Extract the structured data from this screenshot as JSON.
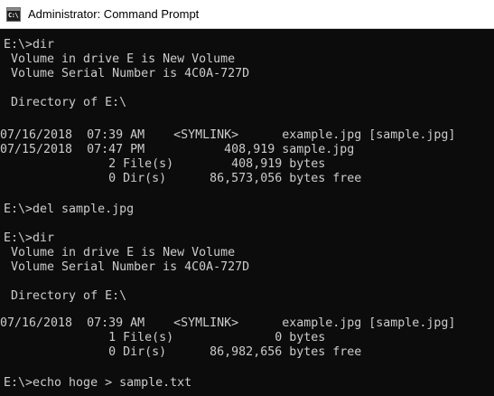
{
  "window": {
    "title": "Administrator: Command Prompt",
    "icon": "console-app-icon",
    "icon_glyph": "C:\\",
    "background_color": "#0c0c0c",
    "text_color": "#cccccc"
  },
  "console": {
    "lines": [
      "E:\\>dir",
      " Volume in drive E is New Volume",
      " Volume Serial Number is 4C0A-727D",
      "",
      " Directory of E:\\",
      "",
      "07/16/2018  07:39 AM    <SYMLINK>      example.jpg [sample.jpg]",
      "07/15/2018  07:47 PM           408,919 sample.jpg",
      "               2 File(s)        408,919 bytes",
      "               0 Dir(s)      86,573,056 bytes free",
      "",
      "E:\\>del sample.jpg",
      "",
      "E:\\>dir",
      " Volume in drive E is New Volume",
      " Volume Serial Number is 4C0A-727D",
      "",
      " Directory of E:\\",
      "",
      "07/16/2018  07:39 AM    <SYMLINK>      example.jpg [sample.jpg]",
      "               1 File(s)              0 bytes",
      "               0 Dir(s)      86,982,656 bytes free",
      "",
      "E:\\>echo hoge > sample.txt"
    ]
  }
}
